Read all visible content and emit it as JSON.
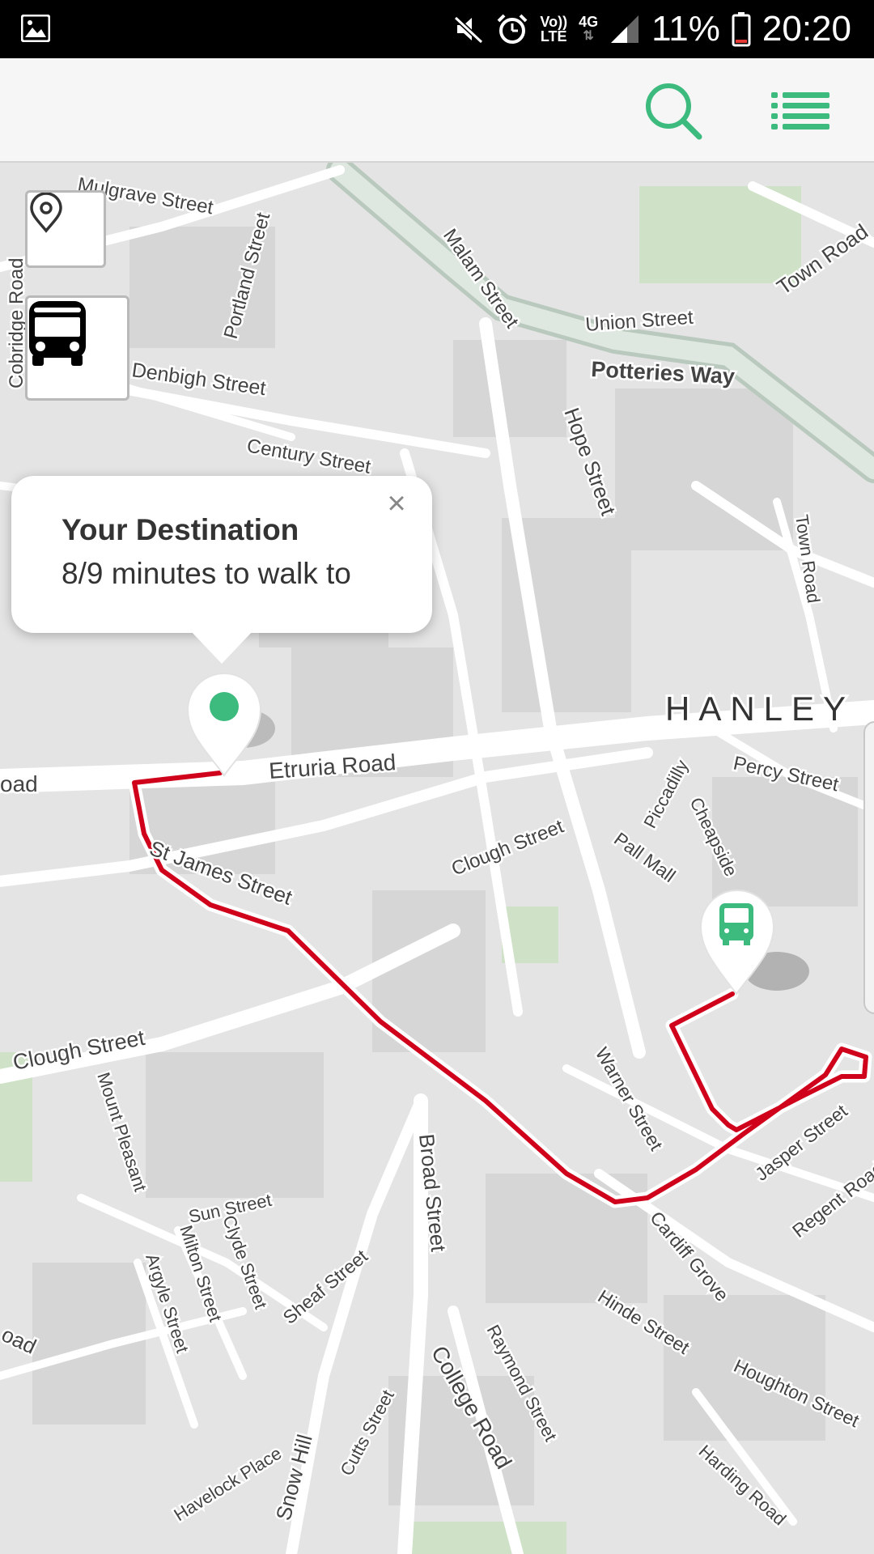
{
  "status_bar": {
    "battery": "11%",
    "time": "20:20",
    "volte_label_top": "Vo))",
    "volte_label_bottom": "LTE",
    "network": "4G",
    "icons": [
      "image-icon",
      "mute-icon",
      "alarm-icon",
      "volte-icon",
      "network-4g-icon",
      "signal-icon",
      "battery-icon"
    ]
  },
  "app_bar": {
    "accent_color": "#3dbb7e",
    "icons": [
      "search-icon",
      "list-menu-icon"
    ]
  },
  "map": {
    "controls": [
      "location-pin-icon",
      "bus-icon"
    ],
    "district_label": "HANLEY",
    "streets": {
      "mulgrave": "Mulgrave Street",
      "cobridge": "Cobridge Road",
      "portland": "Portland Street",
      "denbigh": "Denbigh Street",
      "century": "Century Street",
      "malam": "Malam Street",
      "union": "Union Street",
      "potteries": "Potteries Way",
      "town_road_top": "Town Road",
      "hope": "Hope Street",
      "town_road_mid": "Town Road",
      "etruria": "Etruria Road",
      "road_left": "oad",
      "percy": "Percy Street",
      "piccadilly": "Piccadilly",
      "cheapside": "Cheapside",
      "clough_mid": "Clough Street",
      "pall_mall": "Pall Mall",
      "st_james": "St James Street",
      "clough_left": "Clough Street",
      "mount_pleasant": "Mount Pleasant",
      "warner": "Warner Street",
      "jasper": "Jasper Street",
      "regent": "Regent Road",
      "broad": "Broad Street",
      "sun": "Sun Street",
      "clyde": "Clyde Street",
      "milton": "Milton Street",
      "argyle": "Argyle Street",
      "sheaf": "Sheaf Street",
      "cardiff": "Cardiff Grove",
      "hinde": "Hinde Street",
      "houghton": "Houghton Street",
      "college": "College Road",
      "raymond": "Raymond Street",
      "cutts": "Cutts Street",
      "snow_hill": "Snow Hill",
      "havelock": "Havelock Place",
      "harding": "Harding Road",
      "road_bottom_left": "oad"
    },
    "route_color": "#d0021b",
    "marker_color": "#3dbb7e",
    "destination_marker_icon": "destination-dot-icon",
    "stop_marker_icon": "bus-stop-icon"
  },
  "popup": {
    "title": "Your Destination",
    "body": "8/9 minutes to walk to",
    "close_label": "×"
  }
}
